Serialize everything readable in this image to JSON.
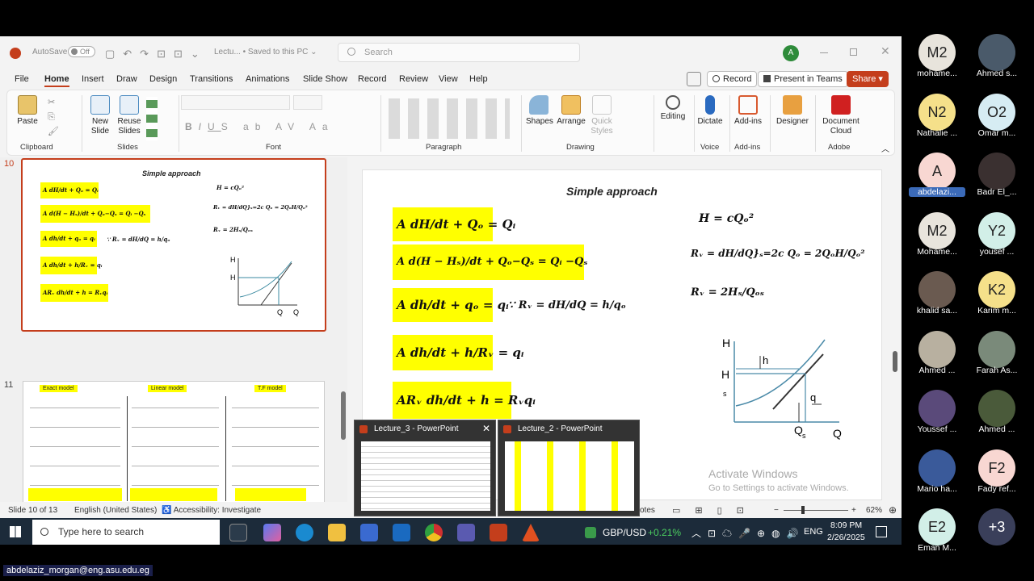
{
  "app": {
    "autosave_label": "AutoSave",
    "autosave_state": "Off",
    "doc_title": "Lectu... • Saved to this PC ⌄",
    "search_placeholder": "Search",
    "user_initial": "A"
  },
  "menu": [
    "File",
    "Home",
    "Insert",
    "Draw",
    "Design",
    "Transitions",
    "Animations",
    "Slide Show",
    "Record",
    "Review",
    "View",
    "Help"
  ],
  "menu_right": {
    "record": "Record",
    "present": "Present in Teams",
    "share": "Share"
  },
  "ribbon": {
    "clipboard": {
      "paste": "Paste",
      "group": "Clipboard"
    },
    "slides": {
      "new_slide": "New Slide",
      "reuse": "Reuse Slides",
      "group": "Slides"
    },
    "font": {
      "group": "Font"
    },
    "paragraph": {
      "group": "Paragraph"
    },
    "drawing": {
      "shapes": "Shapes",
      "arrange": "Arrange",
      "quick": "Quick Styles",
      "group": "Drawing"
    },
    "editing": {
      "label": "Editing"
    },
    "voice": {
      "dictate": "Dictate",
      "group": "Voice"
    },
    "addins": {
      "label": "Add-ins",
      "group": "Add-ins"
    },
    "designer": {
      "label": "Designer"
    },
    "adobe": {
      "label": "Document Cloud",
      "group": "Adobe"
    }
  },
  "thumbs": {
    "s10": {
      "num": "10",
      "title": "Simple approach"
    },
    "s11": {
      "num": "11",
      "h1": "Exact model",
      "h2": "Linear model",
      "h3": "T.F model"
    }
  },
  "slide": {
    "title": "Simple approach",
    "eq1": "A dH/dt + Qₒ = Qᵢ",
    "eq2": "A d(H − Hₛ)/dt + Qₒ−Qₛ = Qᵢ −Qₛ",
    "eq3": "A dh/dt + qₒ = qᵢ",
    "eq3b": "∵ Rᵥ = dH/dQ = h/qₒ",
    "eq4": "A dh/dt + h/Rᵥ = qᵢ",
    "eq5": "ARᵥ dh/dt + h = Rᵥqᵢ",
    "r1": "H = cQₒ²",
    "r2": "Rᵥ = dH/dQ}ₛ=2c Qₒ = 2QₒH/Qₒ²",
    "r3": "Rᵥ = 2Hₛ/Qₒₛ",
    "g_H": "H",
    "g_Hs": "H",
    "g_s": "s",
    "g_h": "h",
    "g_q": "q",
    "g_Qs": "Q",
    "g_Qs_sub": "s",
    "g_Q": "Q"
  },
  "watermark": {
    "line1": "Activate Windows",
    "line2": "Go to Settings to activate Windows."
  },
  "status": {
    "slide": "Slide 10 of 13",
    "lang": "English (United States)",
    "access": "Accessibility: Investigate",
    "notes": "otes",
    "zoom": "62%"
  },
  "previews": [
    {
      "title": "Lecture_3 - PowerPoint"
    },
    {
      "title": "Lecture_2 - PowerPoint"
    }
  ],
  "taskbar": {
    "search": "Type here to search",
    "ticker": "GBP/USD",
    "change": "+0.21%",
    "lang": "ENG",
    "time": "8:09 PM",
    "date": "2/26/2025"
  },
  "participants": [
    {
      "initials": "M2",
      "name": "mohame...",
      "color": "#e8e4dc"
    },
    {
      "initials": "",
      "name": "Ahmed s...",
      "color": "#4a5a6a"
    },
    {
      "initials": "N2",
      "name": "Nathalie ...",
      "color": "#f5e08a"
    },
    {
      "initials": "O2",
      "name": "Omar m...",
      "color": "#d6ecf3"
    },
    {
      "initials": "A",
      "name": "abdelazi...",
      "color": "#f8d7d2"
    },
    {
      "initials": "",
      "name": "Badr El_...",
      "color": "#3a3030"
    },
    {
      "initials": "M2",
      "name": "Mohame...",
      "color": "#e8e4dc"
    },
    {
      "initials": "Y2",
      "name": "yousef ...",
      "color": "#d2efe8"
    },
    {
      "initials": "",
      "name": "khalid sa...",
      "color": "#6a5a50"
    },
    {
      "initials": "K2",
      "name": "Karim m...",
      "color": "#f5e08a"
    },
    {
      "initials": "",
      "name": "Ahmed ...",
      "color": "#b8b0a0"
    },
    {
      "initials": "",
      "name": "Farah As...",
      "color": "#7a8a7a"
    },
    {
      "initials": "",
      "name": "Youssef ...",
      "color": "#5a4a7a"
    },
    {
      "initials": "",
      "name": "Ahmed ...",
      "color": "#4a5a3a"
    },
    {
      "initials": "",
      "name": "Mario ha...",
      "color": "#3a5a9a"
    },
    {
      "initials": "F2",
      "name": "Fady ref...",
      "color": "#f8d7d2"
    },
    {
      "initials": "E2",
      "name": "Eman M...",
      "color": "#d2efe8"
    },
    {
      "initials": "+3",
      "name": "",
      "color": "#3a3f5a"
    }
  ],
  "footer_email": "abdelaziz_morgan@eng.asu.edu.eg"
}
